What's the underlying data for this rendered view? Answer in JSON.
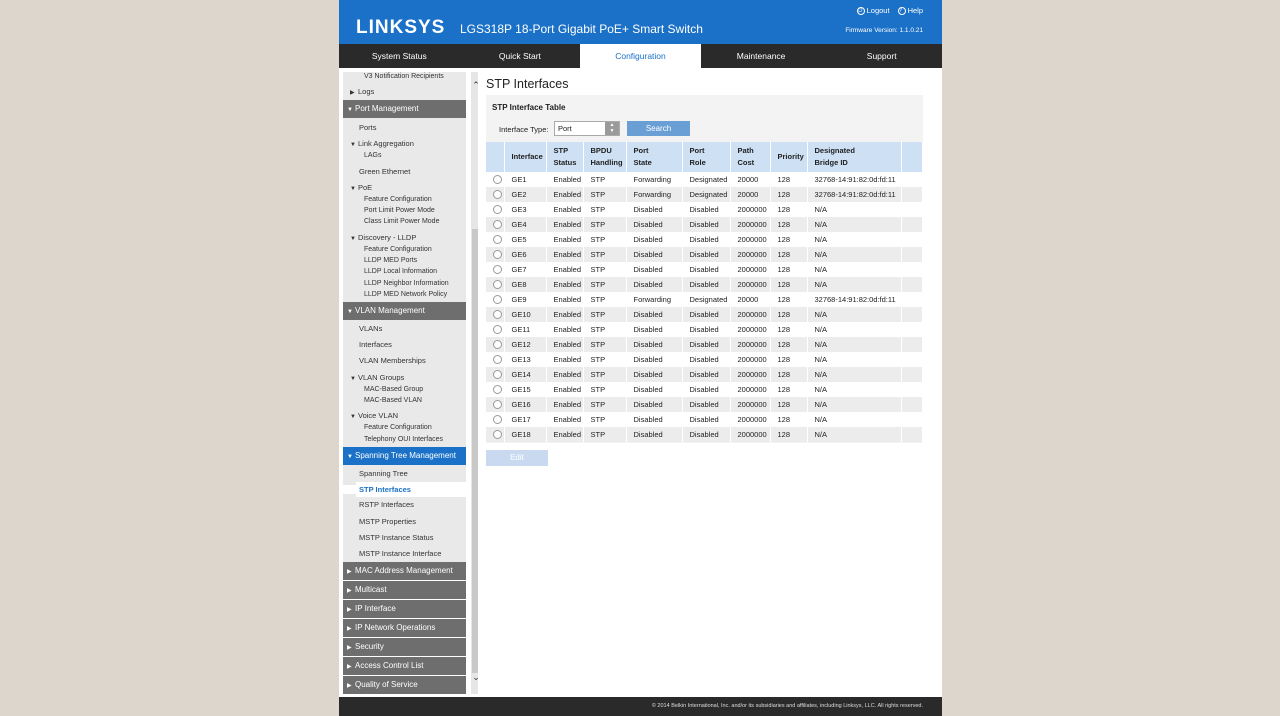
{
  "header": {
    "logo": "LINKSYS",
    "product": "LGS318P 18-Port Gigabit PoE+ Smart Switch",
    "logout": "Logout",
    "help": "Help",
    "firmware": "Firmware Version: 1.1.0.21"
  },
  "tabs": [
    "System Status",
    "Quick Start",
    "Configuration",
    "Maintenance",
    "Support"
  ],
  "sidebar": {
    "items": [
      "V3 Notification Recipients",
      "Logs",
      "Port Management",
      "Ports",
      "Link Aggregation",
      "LAGs",
      "Green Ethernet",
      "PoE",
      "Feature Configuration",
      "Port Limit Power Mode",
      "Class Limit Power Mode",
      "Discovery - LLDP",
      "Feature Configuration",
      "LLDP MED Ports",
      "LLDP Local Information",
      "LLDP Neighbor Information",
      "LLDP MED Network Policy",
      "VLAN Management",
      "VLANs",
      "Interfaces",
      "VLAN Memberships",
      "VLAN Groups",
      "MAC-Based Group",
      "MAC-Based VLAN",
      "Voice VLAN",
      "Feature Configuration",
      "Telephony OUI Interfaces",
      "Spanning Tree Management",
      "Spanning Tree",
      "STP Interfaces",
      "RSTP Interfaces",
      "MSTP Properties",
      "MSTP Instance Status",
      "MSTP Instance Interface",
      "MAC Address Management",
      "Multicast",
      "IP Interface",
      "IP Network Operations",
      "Security",
      "Access Control List",
      "Quality of Service"
    ]
  },
  "main": {
    "title": "STP Interfaces",
    "table_title": "STP Interface Table",
    "filter_label": "Interface Type:",
    "filter_value": "Port",
    "search_label": "Search",
    "edit_label": "Edit",
    "columns": [
      [
        "Interface",
        ""
      ],
      [
        "STP",
        "Status"
      ],
      [
        "BPDU",
        "Handling"
      ],
      [
        "Port",
        "State"
      ],
      [
        "Port",
        "Role"
      ],
      [
        "Path",
        "Cost"
      ],
      [
        "Priority",
        ""
      ],
      [
        "Designated",
        "Bridge ID"
      ]
    ],
    "rows": [
      [
        "GE1",
        "Enabled",
        "STP",
        "Forwarding",
        "Designated",
        "20000",
        "128",
        "32768-14:91:82:0d:fd:11"
      ],
      [
        "GE2",
        "Enabled",
        "STP",
        "Forwarding",
        "Designated",
        "20000",
        "128",
        "32768-14:91:82:0d:fd:11"
      ],
      [
        "GE3",
        "Enabled",
        "STP",
        "Disabled",
        "Disabled",
        "2000000",
        "128",
        "N/A"
      ],
      [
        "GE4",
        "Enabled",
        "STP",
        "Disabled",
        "Disabled",
        "2000000",
        "128",
        "N/A"
      ],
      [
        "GE5",
        "Enabled",
        "STP",
        "Disabled",
        "Disabled",
        "2000000",
        "128",
        "N/A"
      ],
      [
        "GE6",
        "Enabled",
        "STP",
        "Disabled",
        "Disabled",
        "2000000",
        "128",
        "N/A"
      ],
      [
        "GE7",
        "Enabled",
        "STP",
        "Disabled",
        "Disabled",
        "2000000",
        "128",
        "N/A"
      ],
      [
        "GE8",
        "Enabled",
        "STP",
        "Disabled",
        "Disabled",
        "2000000",
        "128",
        "N/A"
      ],
      [
        "GE9",
        "Enabled",
        "STP",
        "Forwarding",
        "Designated",
        "20000",
        "128",
        "32768-14:91:82:0d:fd:11"
      ],
      [
        "GE10",
        "Enabled",
        "STP",
        "Disabled",
        "Disabled",
        "2000000",
        "128",
        "N/A"
      ],
      [
        "GE11",
        "Enabled",
        "STP",
        "Disabled",
        "Disabled",
        "2000000",
        "128",
        "N/A"
      ],
      [
        "GE12",
        "Enabled",
        "STP",
        "Disabled",
        "Disabled",
        "2000000",
        "128",
        "N/A"
      ],
      [
        "GE13",
        "Enabled",
        "STP",
        "Disabled",
        "Disabled",
        "2000000",
        "128",
        "N/A"
      ],
      [
        "GE14",
        "Enabled",
        "STP",
        "Disabled",
        "Disabled",
        "2000000",
        "128",
        "N/A"
      ],
      [
        "GE15",
        "Enabled",
        "STP",
        "Disabled",
        "Disabled",
        "2000000",
        "128",
        "N/A"
      ],
      [
        "GE16",
        "Enabled",
        "STP",
        "Disabled",
        "Disabled",
        "2000000",
        "128",
        "N/A"
      ],
      [
        "GE17",
        "Enabled",
        "STP",
        "Disabled",
        "Disabled",
        "2000000",
        "128",
        "N/A"
      ],
      [
        "GE18",
        "Enabled",
        "STP",
        "Disabled",
        "Disabled",
        "2000000",
        "128",
        "N/A"
      ]
    ]
  },
  "footer": "© 2014 Belkin International, Inc. and/or its subsidiaries and affiliates, including Linksys, LLC. All rights reserved.",
  "colors": {
    "brand": "#1a71c7",
    "nav": "#2a2a2a",
    "table_header": "#cde0f4"
  }
}
